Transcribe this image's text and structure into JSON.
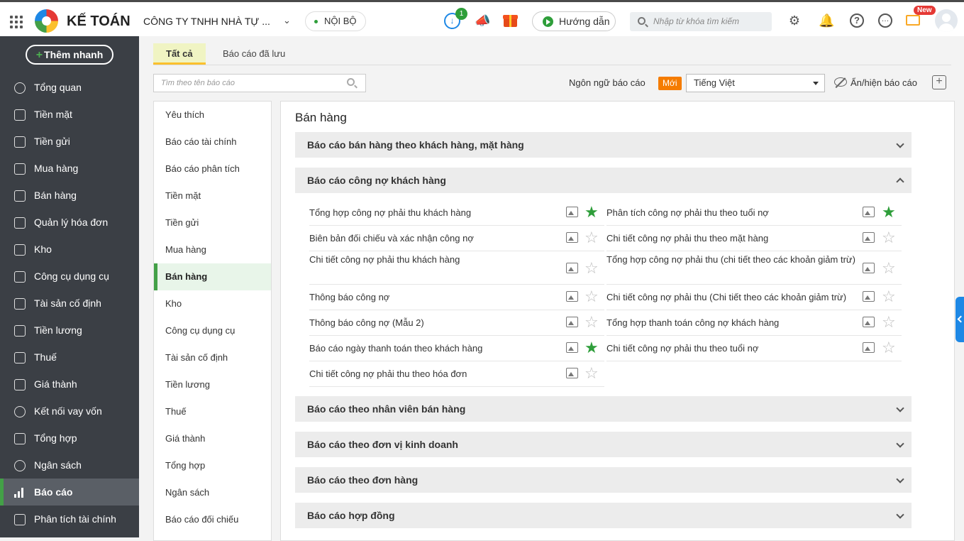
{
  "header": {
    "brand": "KẾ TOÁN",
    "company": "CÔNG TY TNHH NHÀ TỰ ...",
    "scope": "NỘI BỘ",
    "download_badge": "1",
    "guide_label": "Hướng dẫn",
    "search_placeholder": "Nhập từ khóa tìm kiếm",
    "new_badge": "New",
    "icons": [
      "apps-grid-icon",
      "logo-icon",
      "chevron-down-icon",
      "download-icon",
      "megaphone-icon",
      "gift-icon",
      "play-icon",
      "search-icon",
      "gear-icon",
      "bell-icon",
      "help-icon",
      "chat-icon",
      "mail-icon",
      "avatar"
    ]
  },
  "sidebar": {
    "add_branch": "Thêm nhanh",
    "items": [
      {
        "label": "Tổng quan",
        "icon": "overview-icon"
      },
      {
        "label": "Tiền mặt",
        "icon": "cash-icon"
      },
      {
        "label": "Tiền gửi",
        "icon": "bank-icon"
      },
      {
        "label": "Mua hàng",
        "icon": "purchase-icon"
      },
      {
        "label": "Bán hàng",
        "icon": "cart-icon"
      },
      {
        "label": "Quản lý hóa đơn",
        "icon": "invoice-icon"
      },
      {
        "label": "Kho",
        "icon": "warehouse-icon"
      },
      {
        "label": "Công cụ dụng cụ",
        "icon": "tools-icon"
      },
      {
        "label": "Tài sản cố định",
        "icon": "asset-icon"
      },
      {
        "label": "Tiền lương",
        "icon": "salary-icon"
      },
      {
        "label": "Thuế",
        "icon": "tax-icon"
      },
      {
        "label": "Giá thành",
        "icon": "price-tag-icon"
      },
      {
        "label": "Kết nối vay vốn",
        "icon": "loan-icon"
      },
      {
        "label": "Tổng hợp",
        "icon": "ledger-icon"
      },
      {
        "label": "Ngân sách",
        "icon": "budget-icon"
      },
      {
        "label": "Báo cáo",
        "icon": "bar-chart-icon",
        "active": true
      },
      {
        "label": "Phân tích tài chính",
        "icon": "analysis-icon"
      }
    ]
  },
  "tabs": [
    {
      "label": "Tất cả",
      "active": true
    },
    {
      "label": "Báo cáo đã lưu",
      "active": false
    }
  ],
  "toolbar": {
    "report_search_placeholder": "Tìm theo tên báo cáo",
    "lang_label": "Ngôn ngữ báo cáo",
    "new_badge": "Mới",
    "lang_value": "Tiếng Việt",
    "toggle_label": "Ẩn/hiện báo cáo"
  },
  "categories": [
    {
      "label": "Yêu thích"
    },
    {
      "label": "Báo cáo tài chính"
    },
    {
      "label": "Báo cáo phân tích"
    },
    {
      "label": "Tiền mặt"
    },
    {
      "label": "Tiền gửi"
    },
    {
      "label": "Mua hàng"
    },
    {
      "label": "Bán hàng",
      "active": true
    },
    {
      "label": "Kho"
    },
    {
      "label": "Công cụ dụng cụ"
    },
    {
      "label": "Tài sản cố định"
    },
    {
      "label": "Tiền lương"
    },
    {
      "label": "Thuế"
    },
    {
      "label": "Giá thành"
    },
    {
      "label": "Tổng hợp"
    },
    {
      "label": "Ngân sách"
    },
    {
      "label": "Báo cáo đối chiếu"
    }
  ],
  "content": {
    "section_title": "Bán hàng",
    "groups_before": [
      {
        "label": "Báo cáo bán hàng theo khách hàng, mặt hàng",
        "expanded": false
      }
    ],
    "open_group": {
      "label": "Báo cáo công nợ khách hàng",
      "expanded": true
    },
    "reports_left": [
      {
        "name": "Tổng hợp công nợ phải thu khách hàng",
        "favorite": true
      },
      {
        "name": "Biên bản đối chiếu và xác nhận công nợ",
        "favorite": false
      },
      {
        "name": "Chi tiết công nợ phải thu khách hàng",
        "favorite": false
      },
      {
        "name": "Thông báo công nợ",
        "favorite": false
      },
      {
        "name": "Thông báo công nợ (Mẫu 2)",
        "favorite": false
      },
      {
        "name": "Báo cáo ngày thanh toán theo khách hàng",
        "favorite": true
      },
      {
        "name": "Chi tiết công nợ phải thu theo hóa đơn",
        "favorite": false
      }
    ],
    "reports_right": [
      {
        "name": "Phân tích công nợ phải thu theo tuổi nợ",
        "favorite": true
      },
      {
        "name": "Chi tiết công nợ phải thu theo mặt hàng",
        "favorite": false
      },
      {
        "name": "Tổng hợp công nợ phải thu (chi tiết theo các khoản giảm trừ)",
        "favorite": false
      },
      {
        "name": "Chi tiết công nợ phải thu (Chi tiết theo các khoản giảm trừ)",
        "favorite": false
      },
      {
        "name": "Tổng hợp thanh toán công nợ khách hàng",
        "favorite": false
      },
      {
        "name": "Chi tiết công nợ phải thu theo tuổi nợ",
        "favorite": false
      }
    ],
    "groups_after": [
      {
        "label": "Báo cáo theo nhân viên bán hàng",
        "expanded": false
      },
      {
        "label": "Báo cáo theo đơn vị kinh doanh",
        "expanded": false
      },
      {
        "label": "Báo cáo theo đơn hàng",
        "expanded": false
      },
      {
        "label": "Báo cáo hợp đồng",
        "expanded": false
      }
    ]
  },
  "colors": {
    "accent": "#2e9e3a",
    "sidebar_bg": "#3b3f45",
    "badge_orange": "#f57c00",
    "link_blue": "#1e88e5"
  }
}
